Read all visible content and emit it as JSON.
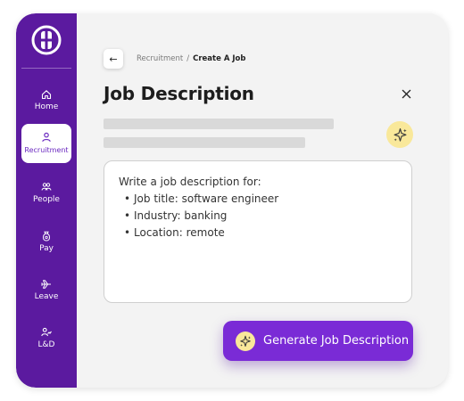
{
  "sidebar": {
    "logo_icon": "circle-logo-icon",
    "items": [
      {
        "label": "Home",
        "icon": "home-icon",
        "active": false
      },
      {
        "label": "Recruitment",
        "icon": "person-icon",
        "active": true
      },
      {
        "label": "People",
        "icon": "people-icon",
        "active": false
      },
      {
        "label": "Pay",
        "icon": "money-bag-icon",
        "active": false
      },
      {
        "label": "Leave",
        "icon": "airplane-icon",
        "active": false
      },
      {
        "label": "L&D",
        "icon": "learning-icon",
        "active": false
      }
    ]
  },
  "breadcrumb": {
    "back_icon": "←",
    "parent": "Recruitment",
    "separator": "/",
    "current": "Create A Job"
  },
  "header": {
    "title": "Job Description",
    "close_icon": "×"
  },
  "prompt": {
    "intro": "Write a job description for:",
    "items": [
      "Job title: software engineer",
      "Industry: banking",
      "Location: remote"
    ]
  },
  "actions": {
    "generate_label": "Generate Job Description"
  },
  "colors": {
    "sidebar_bg": "#5b1a9f",
    "accent": "#7a2bd6",
    "sparkle_bg": "#f9e89a"
  }
}
